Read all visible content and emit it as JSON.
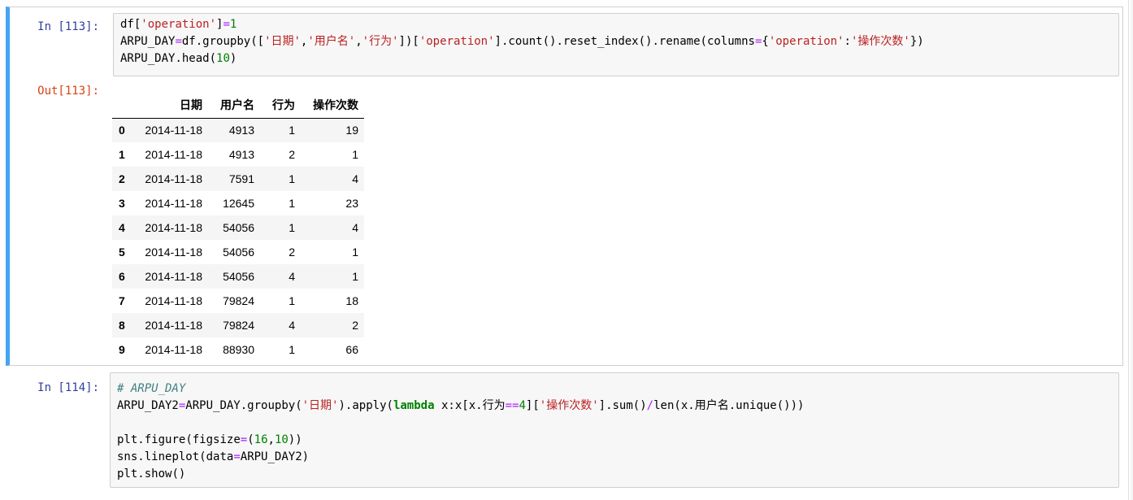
{
  "cells": [
    {
      "in_prompt": "In  [113]:",
      "out_prompt": "Out[113]:",
      "code_lines": [
        "df['operation']=1",
        "ARPU_DAY=df.groupby(['日期','用户名','行为'])['operation'].count().reset_index().rename(columns={'operation':'操作次数'})",
        "ARPU_DAY.head(10)"
      ],
      "table": {
        "columns": [
          "",
          "日期",
          "用户名",
          "行为",
          "操作次数"
        ],
        "rows": [
          [
            "0",
            "2014-11-18",
            "4913",
            "1",
            "19"
          ],
          [
            "1",
            "2014-11-18",
            "4913",
            "2",
            "1"
          ],
          [
            "2",
            "2014-11-18",
            "7591",
            "1",
            "4"
          ],
          [
            "3",
            "2014-11-18",
            "12645",
            "1",
            "23"
          ],
          [
            "4",
            "2014-11-18",
            "54056",
            "1",
            "4"
          ],
          [
            "5",
            "2014-11-18",
            "54056",
            "2",
            "1"
          ],
          [
            "6",
            "2014-11-18",
            "54056",
            "4",
            "1"
          ],
          [
            "7",
            "2014-11-18",
            "79824",
            "1",
            "18"
          ],
          [
            "8",
            "2014-11-18",
            "79824",
            "4",
            "2"
          ],
          [
            "9",
            "2014-11-18",
            "88930",
            "1",
            "66"
          ]
        ]
      }
    },
    {
      "in_prompt": "In  [114]:",
      "code_lines": [
        "# ARPU_DAY",
        "ARPU_DAY2=ARPU_DAY.groupby('日期').apply(lambda x:x[x.行为==4]['操作次数'].sum()/len(x.用户名.unique()))",
        "",
        "plt.figure(figsize=(16,10))",
        "sns.lineplot(data=ARPU_DAY2)",
        "plt.show()"
      ]
    }
  ],
  "colors": {
    "selected_border": "#42a5f5",
    "in_prompt": "#303f9f",
    "out_prompt": "#d84315",
    "string": "#ba2121",
    "number": "#008000",
    "keyword": "#008000",
    "operator": "#aa22ff",
    "comment": "#408080"
  }
}
